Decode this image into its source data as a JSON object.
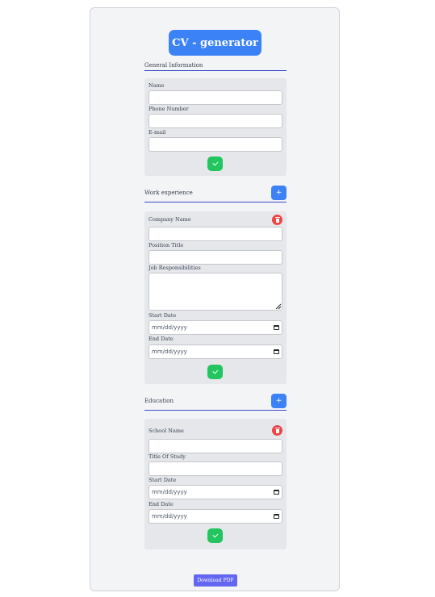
{
  "app": {
    "title": "CV - generator"
  },
  "general": {
    "title": "General Information",
    "name_label": "Name",
    "name_value": "",
    "phone_label": "Phone Number",
    "phone_value": "",
    "email_label": "E-mail",
    "email_value": ""
  },
  "work": {
    "title": "Work experience",
    "add_label": "+",
    "company_label": "Company Name",
    "company_value": "",
    "position_label": "Position Title",
    "position_value": "",
    "responsibilities_label": "Job Responsibilities",
    "responsibilities_value": "",
    "start_label": "Start Date",
    "start_placeholder": "mm/dd/yyyy",
    "end_label": "End Date",
    "end_placeholder": "mm/dd/yyyy"
  },
  "education": {
    "title": "Education",
    "add_label": "+",
    "school_label": "School Name",
    "school_value": "",
    "study_label": "Title Of Study",
    "study_value": "",
    "start_label": "Start Date",
    "start_placeholder": "mm/dd/yyyy",
    "end_label": "End Date",
    "end_placeholder": "mm/dd/yyyy"
  },
  "actions": {
    "download_label": "Download PDF"
  },
  "colors": {
    "primary": "#3b82f6",
    "success": "#22c55e",
    "danger": "#ef4444",
    "download": "#6366f1",
    "section_line": "#3b4cca"
  },
  "icons": [
    "check-icon",
    "plus-icon",
    "trash-icon",
    "calendar-icon",
    "resize-handle-icon"
  ]
}
